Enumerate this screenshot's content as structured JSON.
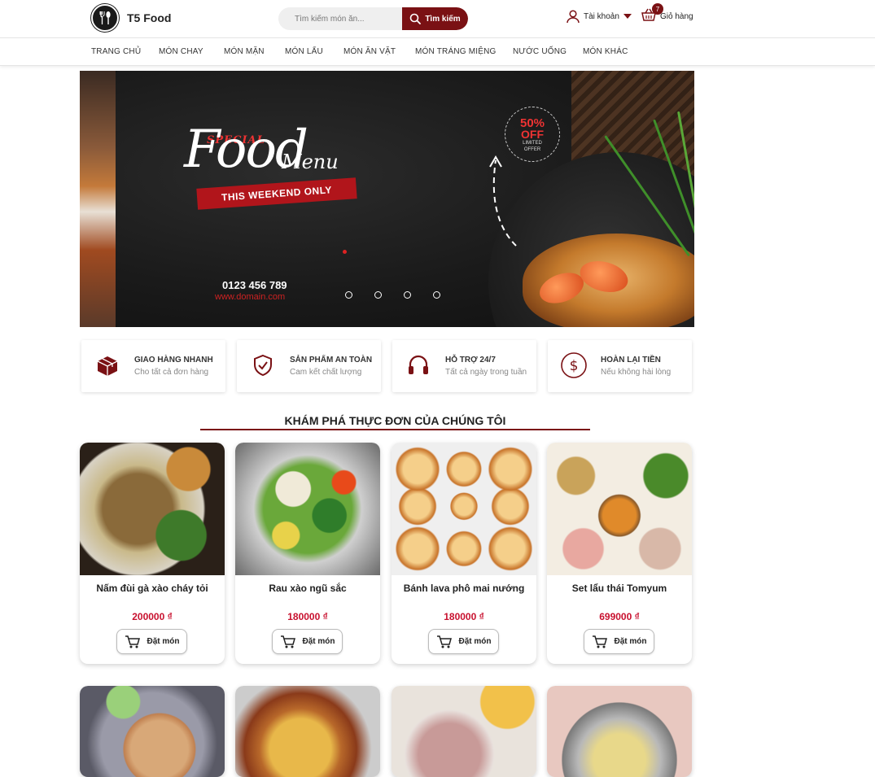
{
  "header": {
    "brand": "T5 Food",
    "logo_icon": "fork-spoon-logo-icon",
    "search": {
      "placeholder": "Tìm kiếm món ăn...",
      "button_label": "Tìm kiếm",
      "icon": "search-icon"
    },
    "account_label": "Tài khoản",
    "cart": {
      "label": "Giỏ hàng",
      "count": "7"
    }
  },
  "nav": {
    "items": [
      "TRANG CHỦ",
      "MÓN CHAY",
      "MÓN MẶN",
      "MÓN LẨU",
      "MÓN ĂN VẶT",
      "MÓN TRÁNG MIỆNG",
      "NƯỚC UỐNG",
      "MÓN KHÁC"
    ]
  },
  "banner": {
    "special": "SPECIAL",
    "food": "Food",
    "menu": "Menu",
    "weekend": "THIS WEEKEND ONLY",
    "discount_percent": "50%",
    "discount_off": "OFF",
    "discount_limited": "LIMITED",
    "discount_offer": "OFFER",
    "phone": "0123 456 789",
    "domain": "www.domain.com",
    "slide_count": 4
  },
  "features": [
    {
      "title": "GIAO HÀNG NHANH",
      "subtitle": "Cho tất cả đơn hàng",
      "icon": "box-icon"
    },
    {
      "title": "SẢN PHẨM AN TOÀN",
      "subtitle": "Cam kết chất lượng",
      "icon": "shield-check-icon"
    },
    {
      "title": "HỖ TRỢ 24/7",
      "subtitle": "Tất cả ngày trong tuần",
      "icon": "headphones-icon"
    },
    {
      "title": "HOÀN LẠI TIỀN",
      "subtitle": "Nếu không hài lòng",
      "icon": "dollar-icon"
    }
  ],
  "menu_section": {
    "title": "KHÁM PHÁ THỰC ĐƠN CỦA CHÚNG TÔI",
    "order_label": "Đặt món",
    "products": [
      {
        "name": "Nấm đùi gà xào cháy tỏi",
        "price": "200000 ₫"
      },
      {
        "name": "Rau xào ngũ sắc",
        "price": "180000 ₫"
      },
      {
        "name": "Bánh lava phô mai nướng",
        "price": "180000 ₫"
      },
      {
        "name": "Set lẩu thái Tomyum",
        "price": "699000 ₫"
      }
    ]
  },
  "colors": {
    "accent": "#7a1114",
    "price": "#c8102e"
  }
}
